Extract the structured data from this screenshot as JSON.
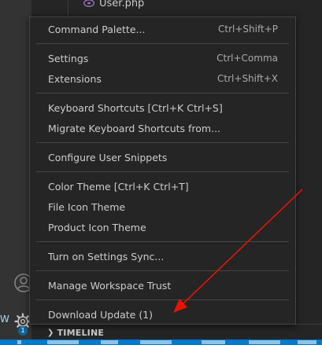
{
  "explorer": {
    "file_name": "User.php",
    "timeline_label": "TIMELINE",
    "left_char": "W"
  },
  "activity": {
    "badge_count": "1"
  },
  "menu": {
    "groups": [
      [
        {
          "label": "Command Palette...",
          "key": "Ctrl+Shift+P"
        }
      ],
      [
        {
          "label": "Settings",
          "key": "Ctrl+Comma"
        },
        {
          "label": "Extensions",
          "key": "Ctrl+Shift+X"
        }
      ],
      [
        {
          "label": "Keyboard Shortcuts [Ctrl+K Ctrl+S]",
          "key": ""
        },
        {
          "label": "Migrate Keyboard Shortcuts from...",
          "key": ""
        }
      ],
      [
        {
          "label": "Configure User Snippets",
          "key": ""
        }
      ],
      [
        {
          "label": "Color Theme [Ctrl+K Ctrl+T]",
          "key": ""
        },
        {
          "label": "File Icon Theme",
          "key": ""
        },
        {
          "label": "Product Icon Theme",
          "key": ""
        }
      ],
      [
        {
          "label": "Turn on Settings Sync...",
          "key": ""
        }
      ],
      [
        {
          "label": "Manage Workspace Trust",
          "key": ""
        }
      ],
      [
        {
          "label": "Download Update (1)",
          "key": ""
        }
      ]
    ]
  },
  "colors": {
    "menu_bg": "#252526",
    "accent": "#007acc",
    "annotation_arrow": "#e51400"
  }
}
